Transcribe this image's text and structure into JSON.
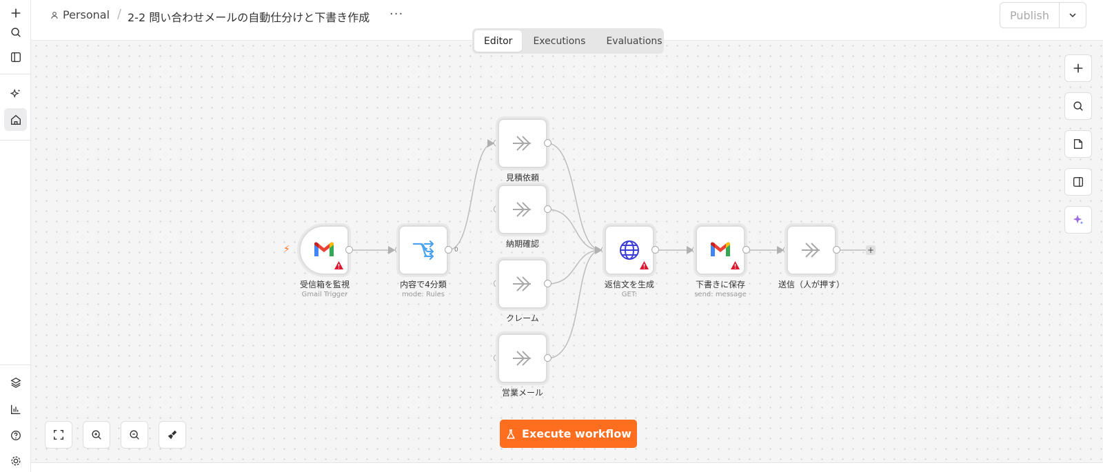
{
  "breadcrumb": {
    "project": "Personal",
    "workflow_title": "2-2 問い合わせメールの自動仕分けと下書き作成",
    "more": "···"
  },
  "publish": {
    "label": "Publish"
  },
  "tabs": [
    {
      "label": "Editor"
    },
    {
      "label": "Executions"
    },
    {
      "label": "Evaluations"
    }
  ],
  "nodes": {
    "gmail_trigger": {
      "label": "受信箱を監視",
      "subtitle": "Gmail Trigger"
    },
    "switch": {
      "label": "内容で4分類",
      "subtitle": "mode: Rules",
      "output_index": "0"
    },
    "quote": {
      "label": "見積依頼"
    },
    "delivery": {
      "label": "納期確認"
    },
    "complaint": {
      "label": "クレーム"
    },
    "sales": {
      "label": "営業メール"
    },
    "http": {
      "label": "返信文を生成",
      "subtitle": "GET:"
    },
    "gmail_draft": {
      "label": "下書きに保存",
      "subtitle": "send: message"
    },
    "send": {
      "label": "送信（人が押す）"
    }
  },
  "execute": {
    "label": "Execute workflow"
  },
  "colors": {
    "accent": "#ff6d1f",
    "warning": "#e0142c",
    "switch_icon": "#4aa3f0",
    "http_icon": "#3a3ad6"
  }
}
